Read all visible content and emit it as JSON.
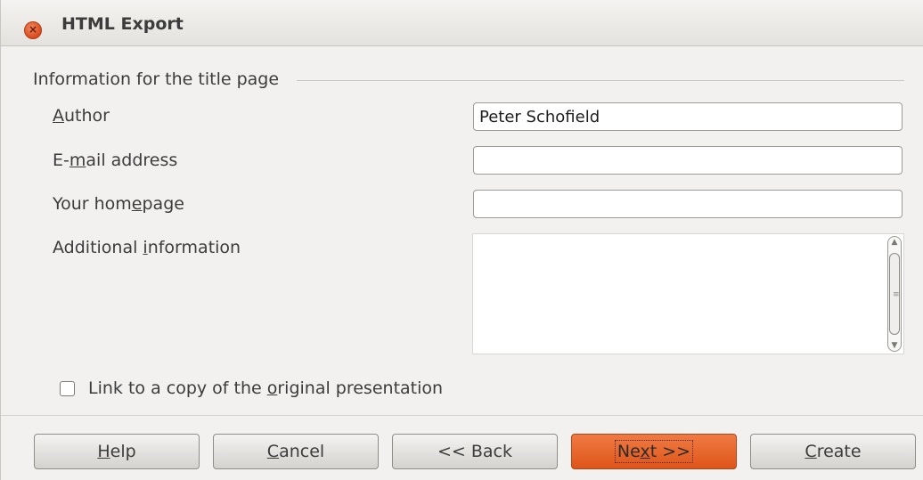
{
  "window": {
    "title": "HTML Export",
    "close_glyph": "×"
  },
  "section": {
    "label": "Information for the title page"
  },
  "fields": {
    "author": {
      "label_pre": "",
      "label_mnemonic": "A",
      "label_post": "uthor",
      "value": "Peter Schofield"
    },
    "email": {
      "label_pre": "E-",
      "label_mnemonic": "m",
      "label_post": "ail address",
      "value": ""
    },
    "homepage": {
      "label_pre": "Your hom",
      "label_mnemonic": "e",
      "label_post": "page",
      "value": ""
    },
    "additional": {
      "label_pre": "Additional ",
      "label_mnemonic": "i",
      "label_post": "nformation",
      "value": ""
    }
  },
  "checkbox": {
    "label_pre": "Link to a copy of the ",
    "label_mnemonic": "o",
    "label_post": "riginal presentation",
    "checked": false
  },
  "buttons": {
    "help": {
      "pre": "",
      "mnemonic": "H",
      "post": "elp"
    },
    "cancel": {
      "pre": "",
      "mnemonic": "C",
      "post": "ancel"
    },
    "back": {
      "pre": "<< Back",
      "mnemonic": "",
      "post": ""
    },
    "next": {
      "pre": "Ne",
      "mnemonic": "x",
      "post": "t >>"
    },
    "create": {
      "pre": "",
      "mnemonic": "C",
      "post": "reate"
    }
  },
  "colors": {
    "accent": "#de5519",
    "background": "#f2f1f0"
  },
  "icons": {
    "close": "close-icon",
    "scroll_up": "scroll-up-arrow-icon",
    "scroll_down": "scroll-down-arrow-icon"
  }
}
